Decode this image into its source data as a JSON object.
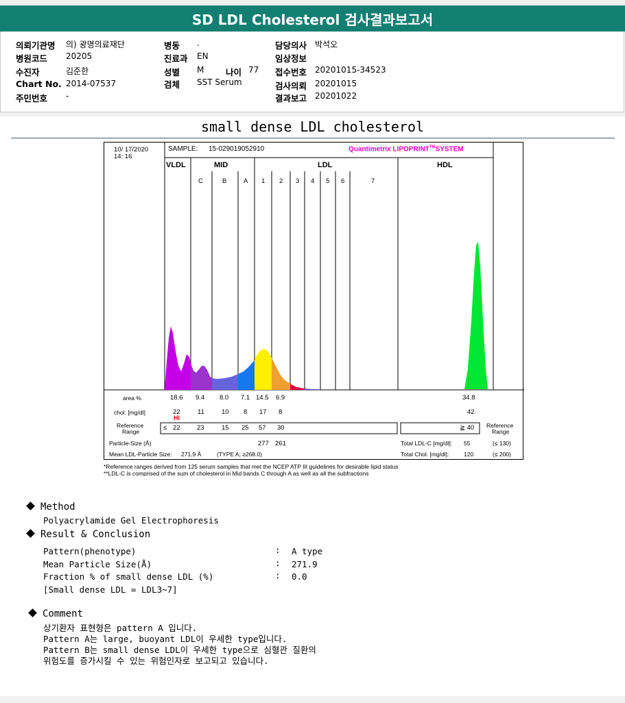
{
  "header": {
    "title": "SD LDL Cholesterol 검사결과보고서"
  },
  "info": {
    "col1": [
      {
        "label": "의뢰기관명",
        "value": "의) 광명의료재단"
      },
      {
        "label": "병원코드",
        "value": "20205"
      },
      {
        "label": "수진자",
        "value": "김준한"
      },
      {
        "label": "Chart No.",
        "value": "2014-07537"
      },
      {
        "label": "주민번호",
        "value": "-"
      }
    ],
    "col2": [
      {
        "label": "병동",
        "value": "."
      },
      {
        "label": "진료과",
        "value": "EN"
      },
      {
        "label": "성별",
        "value": "M"
      },
      {
        "label": "검체",
        "value": "SST Serum"
      }
    ],
    "age": {
      "label": "나이",
      "value": "77"
    },
    "col3": [
      {
        "label": "담당의사",
        "value": "박석오"
      },
      {
        "label": "임상정보",
        "value": ""
      },
      {
        "label": "접수번호",
        "value": "20201015-34523"
      },
      {
        "label": "검사의뢰",
        "value": "20201015"
      },
      {
        "label": "결과보고",
        "value": "20201022"
      }
    ]
  },
  "doc_title": "small dense LDL cholesterol",
  "report": {
    "date": "10/ 17/2020",
    "time": "14: 16",
    "sample_label": "SAMPLE:",
    "sample_id": "15-029019052910",
    "brand_main": "Quantimetrix LIPOPRINT",
    "brand_tm": "TM",
    "brand_tail": "SYSTEM",
    "groups": {
      "vldl": "VLDL",
      "mid": "MID",
      "ldl": "LDL",
      "hdl": "HDL"
    },
    "bands": [
      "C",
      "B",
      "A",
      "1",
      "2",
      "3",
      "4",
      "5",
      "6",
      "7"
    ],
    "row_labels": {
      "area": "area %",
      "chol": "chol. [mg/dl]",
      "ref1": "Reference",
      "ref2": "Range",
      "particle": "Particle-Size (Å)",
      "mean": "Mean LDL-Particle Size:"
    },
    "area_values": [
      "18.6",
      "9.4",
      "8.0",
      "7.1",
      "14.5",
      "6.9"
    ],
    "hdl_area": "34.8",
    "chol_values": [
      "22",
      "11",
      "10",
      "8",
      "17",
      "8"
    ],
    "hdl_chol": "42",
    "hi_flag": "HI",
    "ref_prefix": "≤",
    "ref_values": [
      "22",
      "23",
      "15",
      "25",
      "57",
      "30"
    ],
    "hdl_ref": "≧ 40",
    "right_ref1": "Reference",
    "right_ref2": "Range",
    "particle_values": [
      "277",
      "261"
    ],
    "mean_value": "271.9 Å",
    "mean_type": "(TYPE A; ≥268.0)",
    "total_ldl_label": "Total LDL-C [mg/dl]:",
    "total_ldl_value": "55",
    "total_ldl_ref": "(≤ 130)",
    "total_chol_label": "Total Chol. [mg/dl]:",
    "total_chol_value": "120",
    "total_chol_ref": "(≤ 200)"
  },
  "footnotes": [
    "*Reference ranges derived from 125 serum samples that met the NCEP ATP III guidelines for desirable lipid status",
    "**LDL-C is comprised of the sum of cholesterol in Mid bands C through A as well as all the subfractions"
  ],
  "method": {
    "title": "Method",
    "text": "Polyacrylamide Gel Electrophoresis"
  },
  "result": {
    "title": "Result & Conclusion",
    "rows": [
      {
        "label": "Pattern(phenotype)",
        "sep": ":",
        "value": "A type"
      },
      {
        "label": "Mean Particle Size(Å)",
        "sep": ":",
        "value": "271.9"
      },
      {
        "label": "Fraction % of small dense LDL (%)",
        "sep": ":",
        "value": "0.0"
      }
    ],
    "note": "[Small dense LDL = LDL3~7]"
  },
  "comment": {
    "title": "Comment",
    "lines": [
      "상기환자 표현형은 pattern A 입니다.",
      "Pattern A는 large, buoyant LDL이 우세한 type입니다.",
      "Pattern B는 small dense LDL이 우세한 type으로 심혈관 질환의",
      "위험도를 증가시킬 수 있는 위험인자로 보고되고 있습니다."
    ]
  },
  "colors": {
    "header_bg": "#137e72",
    "vldl": "#c400e6",
    "mid_c": "#9933cc",
    "mid_b": "#6464dc",
    "mid_a": "#1478f0",
    "ldl1": "#ffee00",
    "ldl2": "#f0a030",
    "ldl3": "#e60046",
    "hdl": "#00e632",
    "brand": "#e600c8",
    "hi": "#e60000"
  }
}
